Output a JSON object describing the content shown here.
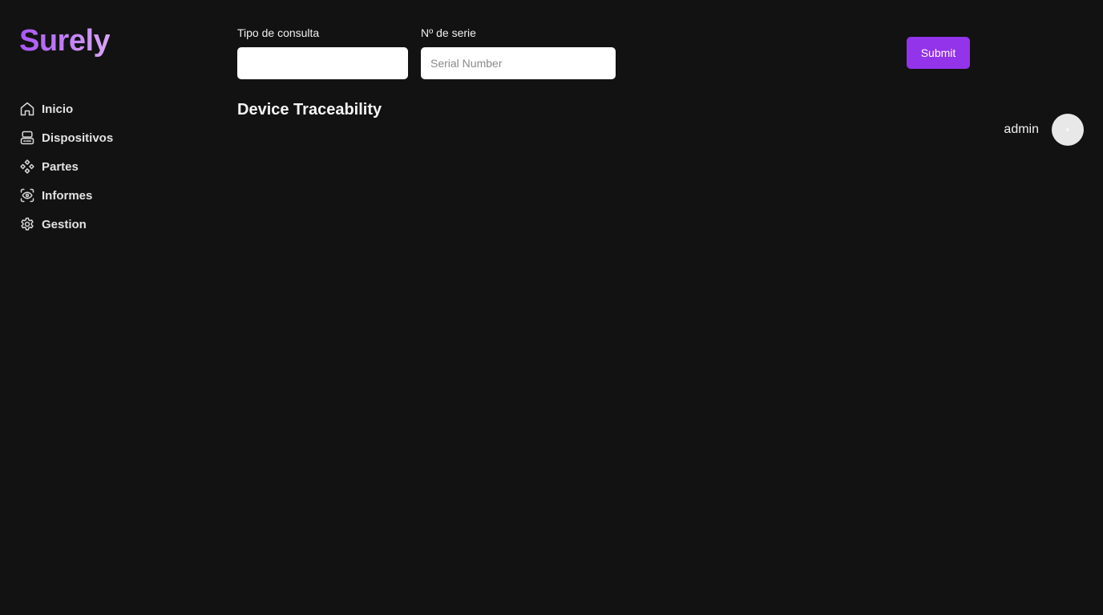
{
  "brand": {
    "name": "Surely",
    "gradient_start": "#a855f7",
    "gradient_end": "#d8a6f5"
  },
  "sidebar": {
    "items": [
      {
        "label": "Inicio",
        "icon": "home-icon"
      },
      {
        "label": "Dispositivos",
        "icon": "server-icon"
      },
      {
        "label": "Partes",
        "icon": "components-icon"
      },
      {
        "label": "Informes",
        "icon": "eye-scan-icon"
      },
      {
        "label": "Gestion",
        "icon": "gear-icon"
      }
    ]
  },
  "query": {
    "tipo": {
      "label": "Tipo de consulta",
      "value": "",
      "placeholder": ""
    },
    "serie": {
      "label": "Nº de serie",
      "value": "",
      "placeholder": "Serial Number"
    },
    "submit_label": "Submit",
    "accent": "#9333ea"
  },
  "main": {
    "title": "Device Traceability"
  },
  "user": {
    "name": "admin"
  },
  "colors": {
    "background": "#121212"
  }
}
